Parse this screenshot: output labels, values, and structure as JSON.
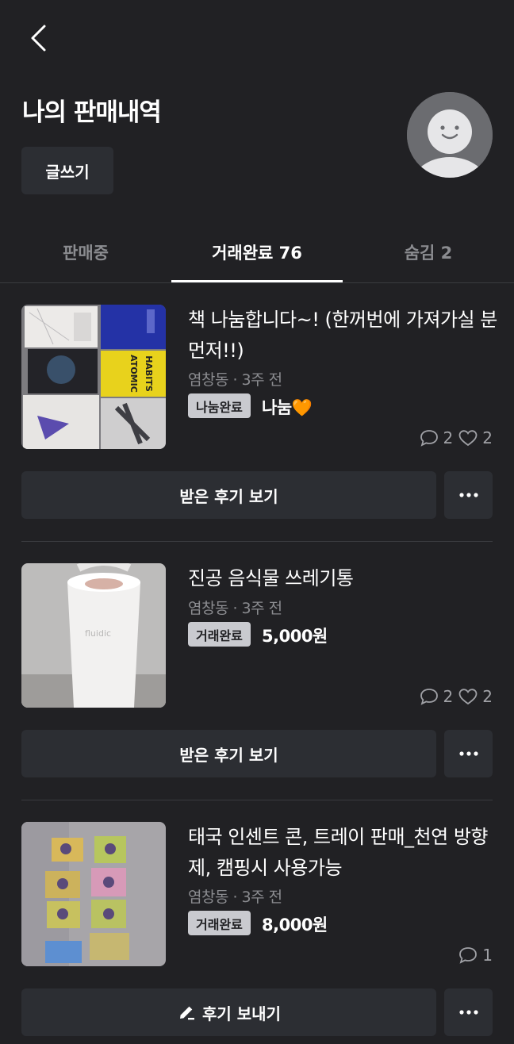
{
  "header": {
    "title": "나의 판매내역",
    "write_label": "글쓰기"
  },
  "tabs": [
    {
      "label": "판매중",
      "active": false
    },
    {
      "label": "거래완료 76",
      "active": true
    },
    {
      "label": "숨김 2",
      "active": false
    }
  ],
  "items": [
    {
      "title": "책 나눔합니다~! (한꺼번에 가져가실 분 먼저!!)",
      "meta": "염창동 · 3주 전",
      "badge": "나눔완료",
      "price": "나눔🧡",
      "comments": "2",
      "likes": "2",
      "action_label": "받은 후기 보기",
      "action_icon": null
    },
    {
      "title": "진공 음식물 쓰레기통",
      "meta": "염창동 · 3주 전",
      "badge": "거래완료",
      "price": "5,000원",
      "comments": "2",
      "likes": "2",
      "action_label": "받은 후기 보기",
      "action_icon": null
    },
    {
      "title": "태국 인센트 콘, 트레이 판매_천연 방향제, 캠핑시 사용가능",
      "meta": "염창동 · 3주 전",
      "badge": "거래완료",
      "price": "8,000원",
      "comments": "1",
      "likes": null,
      "action_label": "후기 보내기",
      "action_icon": "pencil-icon"
    }
  ],
  "thumb_labels": {
    "item2_brand": "fluidic",
    "item1_book": "ATOMIC HABITS"
  },
  "colors": {
    "background": "#212124",
    "surface": "#2c2e33",
    "badge_bg": "#c9cacf",
    "muted_text": "#8b8c90"
  }
}
